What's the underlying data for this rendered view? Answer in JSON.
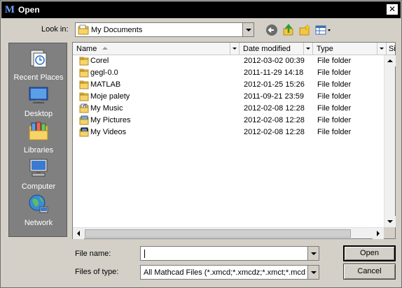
{
  "window": {
    "title": "Open",
    "app_glyph": "M"
  },
  "lookin": {
    "label": "Look in:",
    "value": "My Documents"
  },
  "toolbar": {
    "back_icon": "back-arrow-icon",
    "up_icon": "up-folder-icon",
    "new_folder_icon": "new-folder-icon",
    "views_icon": "views-menu-icon"
  },
  "places": [
    {
      "label": "Recent Places",
      "icon": "recent-places-icon"
    },
    {
      "label": "Desktop",
      "icon": "desktop-icon"
    },
    {
      "label": "Libraries",
      "icon": "libraries-icon"
    },
    {
      "label": "Computer",
      "icon": "computer-icon"
    },
    {
      "label": "Network",
      "icon": "network-icon"
    }
  ],
  "columns": {
    "name": "Name",
    "date": "Date modified",
    "type": "Type",
    "size": "Si"
  },
  "files": [
    {
      "name": "Corel",
      "date": "2012-03-02 00:39",
      "type": "File folder",
      "icon": "folder"
    },
    {
      "name": "gegl-0.0",
      "date": "2011-11-29 14:18",
      "type": "File folder",
      "icon": "folder"
    },
    {
      "name": "MATLAB",
      "date": "2012-01-25 15:26",
      "type": "File folder",
      "icon": "folder"
    },
    {
      "name": "Moje palety",
      "date": "2011-09-21 23:59",
      "type": "File folder",
      "icon": "folder"
    },
    {
      "name": "My Music",
      "date": "2012-02-08 12:28",
      "type": "File folder",
      "icon": "music"
    },
    {
      "name": "My Pictures",
      "date": "2012-02-08 12:28",
      "type": "File folder",
      "icon": "pictures"
    },
    {
      "name": "My Videos",
      "date": "2012-02-08 12:28",
      "type": "File folder",
      "icon": "videos"
    }
  ],
  "filename": {
    "label": "File name:",
    "value": ""
  },
  "filetype": {
    "label": "Files of type:",
    "value": "All Mathcad Files (*.xmcd;*.xmcdz;*.xmct;*.mcd;*.mct;*.mcdz)"
  },
  "buttons": {
    "open": "Open",
    "cancel": "Cancel"
  },
  "colors": {
    "titlebar": "#000000",
    "dialog": "#d4d0c8",
    "places_bar": "#808080",
    "folder": "#f4c542"
  }
}
